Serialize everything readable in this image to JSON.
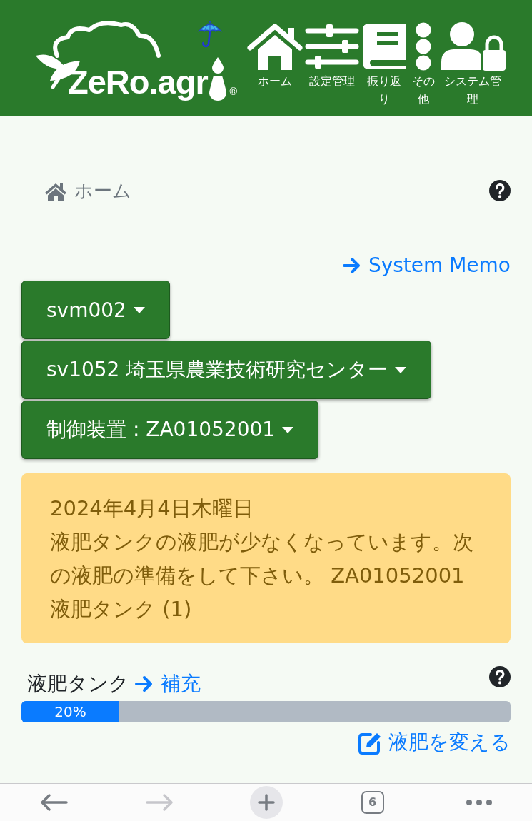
{
  "header": {
    "logo": {
      "wordmark": "ZeRo.agr",
      "registered_mark": "®"
    },
    "nav": [
      {
        "kind": "home",
        "label": "ホーム"
      },
      {
        "kind": "settings",
        "label": "設定管理"
      },
      {
        "kind": "review",
        "label": "振り返り"
      },
      {
        "kind": "more",
        "label": "その他"
      },
      {
        "kind": "admin",
        "label": "システム管理"
      }
    ]
  },
  "breadcrumb": [
    {
      "label": "ホーム"
    }
  ],
  "system_memo_link": {
    "label": "System Memo"
  },
  "dropdowns": [
    {
      "label": "svm002"
    },
    {
      "label": "sv1052 埼玉県農業技術研究センター"
    },
    {
      "label": "制御装置 : ZA01052001"
    }
  ],
  "alert": {
    "date": "2024年4月4日木曜日",
    "message": "液肥タンクの液肥が少なくなっています。次の液肥の準備をして下さい。 ZA01052001　液肥タンク (1)"
  },
  "tank": {
    "label": "液肥タンク",
    "refill_link": "補充",
    "progress": {
      "level": 0.2,
      "label": "20%"
    },
    "change_link": "液肥を変える"
  },
  "browser_toolbar": [
    {
      "kind": "back",
      "disabled": false
    },
    {
      "kind": "forward",
      "disabled": true
    },
    {
      "kind": "new_tab",
      "disabled": false
    },
    {
      "kind": "tabs",
      "count": "6",
      "disabled": false
    },
    {
      "kind": "more",
      "disabled": false
    }
  ]
}
